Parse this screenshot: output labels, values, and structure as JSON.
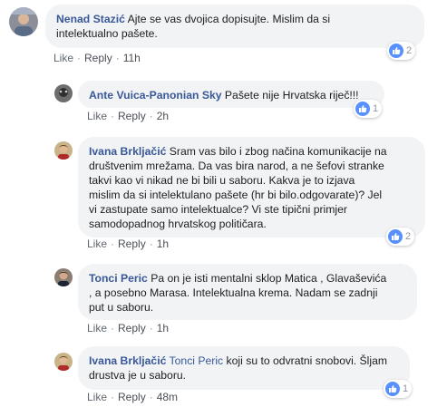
{
  "colors": {
    "link": "#385898",
    "bubble": "#f2f3f5",
    "like_blue": "#5890ff",
    "muted": "#90949c"
  },
  "actions": {
    "like": "Like",
    "reply": "Reply",
    "dot": "·"
  },
  "comments": [
    {
      "author": "Nenad Stazić",
      "text_lines": [
        "Ajte se vas dvojica dopisujte. Mislim da si",
        "intelektualno pašete."
      ],
      "time": "11h",
      "reactions": "2"
    },
    {
      "author": "Ante Vuica-Panonian Sky",
      "text_lines": [
        "Pašete nije Hrvatska riječ!!!"
      ],
      "time": "2h",
      "reactions": "1"
    },
    {
      "author": "Ivana Brkljačić",
      "text_lines": [
        "Sram vas bilo i zbog načina komunikacije na",
        "društvenim mrežama. Da vas bira narod, a ne šefovi stranke",
        "takvi kao vi nikad ne bi bili u saboru. Kakva je to izjava",
        "mislim da si intelektulano pašete (hr bi bilo.odgovarate)? Jel",
        "vi zastupate samo intelektualce? Vi ste tipični primjer",
        "samodopadnog hrvatskog političara."
      ],
      "time": "1h",
      "reactions": "2"
    },
    {
      "author": "Tonci Peric",
      "text_lines": [
        "Pa on je isti mentalni sklop Matica , Glavaševića",
        ", a posebno Marasa. Intelektualna krema. Nadam se zadnji",
        "put u saboru."
      ],
      "time": "1h",
      "reactions": ""
    },
    {
      "author": "Ivana Brkljačić",
      "tag": "Tonci Peric",
      "text_lines": [
        "koji su to odvratni snobovi. Šljam",
        "drustva je u saboru."
      ],
      "time": "48m",
      "reactions": "1"
    }
  ]
}
